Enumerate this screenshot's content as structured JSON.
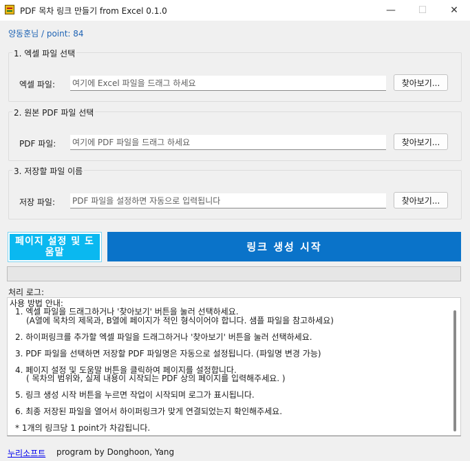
{
  "window": {
    "title": "PDF 목차 링크 만들기 from Excel 0.1.0",
    "minimize_glyph": "—",
    "maximize_glyph": "☐",
    "close_glyph": "✕"
  },
  "user_info": "양동훈님 / point: 84",
  "groups": [
    {
      "title": "1. 엑셀 파일 선택",
      "label": "엑셀 파일:",
      "placeholder": "여기에 Excel 파일을 드래그 하세요",
      "value": "",
      "browse": "찾아보기..."
    },
    {
      "title": "2. 원본 PDF 파일 선택",
      "label": "PDF 파일:",
      "placeholder": "여기에 PDF 파일을 드래그 하세요",
      "value": "",
      "browse": "찾아보기..."
    },
    {
      "title": "3. 저장할 파일 이름",
      "label": "저장 파일:",
      "placeholder": "PDF 파일을 설정하면 자동으로 입력됩니다",
      "value": "",
      "browse": "찾아보기..."
    }
  ],
  "buttons": {
    "help": "페이지 설정 및 도움말",
    "start": "링크 생성 시작"
  },
  "progress": {
    "fraction": 0
  },
  "log": {
    "label": "처리 로그:",
    "lines": [
      "사용 방법 안내:",
      "1. 엑셀 파일을 드래그하거나 '찾아보기' 버튼을 눌러 선택하세요.",
      "(A열에 목차의 제목과, B열에 페이지가 적인 형식이어야 합니다.  샘플 파일을 참고하세요)",
      "2. 하이퍼링크를 추가할 엑셀 파일을 드래그하거나 '찾아보기' 버튼을 눌러 선택하세요.",
      "3. PDF 파일을 선택하면 저장할 PDF 파일명은 자동으로 설정됩니다. (파일명 변경 가능)",
      "4. 페이지 설정 및 도움말 버튼을 클릭하여 페이지를 설정합니다.",
      "( 목차의 범위와, 실제 내용이 시작되는 PDF 상의 페이지를 입력해주세요. )",
      "5. 링크 생성 시작 버튼을 누르면 작업이 시작되며 로그가 표시됩니다.",
      "6. 최종 저장된 파일을 열어서 하이퍼링크가 맞게 연결되었는지 확인해주세요.",
      "* 1개의 링크당 1 point가 차감됩니다."
    ]
  },
  "footer": {
    "link": "누리소프트",
    "credit": "program by Donghoon, Yang"
  },
  "colors": {
    "help_button": "#0ab8f0",
    "start_button": "#0a73c9",
    "user_info": "#1e63b4",
    "link": "#0000ee"
  }
}
